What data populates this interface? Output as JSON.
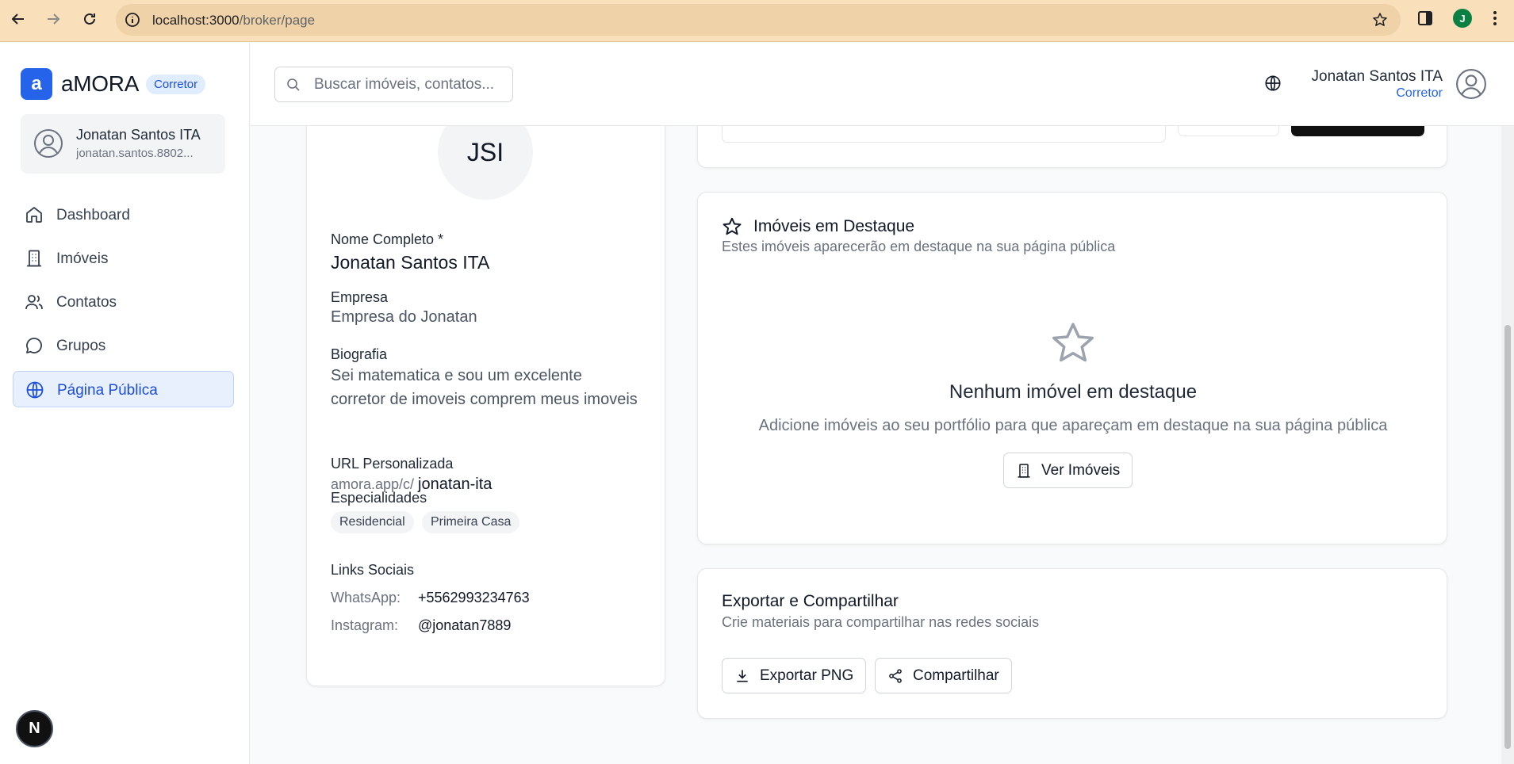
{
  "browser": {
    "url_host": "localhost:3000",
    "url_path": "/broker/page",
    "profile_initial": "J"
  },
  "sidebar": {
    "logo_letter": "a",
    "brand": "aMORA",
    "badge": "Corretor",
    "user_name": "Jonatan Santos ITA",
    "user_email": "jonatan.santos.8802...",
    "items": [
      {
        "label": "Dashboard",
        "icon": "home-icon"
      },
      {
        "label": "Imóveis",
        "icon": "building-icon"
      },
      {
        "label": "Contatos",
        "icon": "users-icon"
      },
      {
        "label": "Grupos",
        "icon": "chat-bubble-icon"
      },
      {
        "label": "Página Pública",
        "icon": "globe-icon",
        "active": true
      }
    ],
    "framework_badge": "N"
  },
  "header": {
    "search_placeholder": "Buscar imóveis, contatos...",
    "user_name": "Jonatan Santos ITA",
    "user_role": "Corretor"
  },
  "profile": {
    "initials": "JSI",
    "full_name_label": "Nome Completo *",
    "full_name": "Jonatan Santos ITA",
    "company_label": "Empresa",
    "company": "Empresa do Jonatan",
    "bio_label": "Biografia",
    "bio": "Sei matematica e sou um excelente corretor de imoveis comprem meus imoveis",
    "url_label": "URL Personalizada",
    "url_prefix": "amora.app/c/",
    "url_slug": "jonatan-ita",
    "specialties_label": "Especialidades",
    "specialties": [
      "Residencial",
      "Primeira Casa"
    ],
    "social_label": "Links Sociais",
    "whatsapp_key": "WhatsApp:",
    "whatsapp": "+5562993234763",
    "instagram_key": "Instagram:",
    "instagram": "@jonatan7889"
  },
  "featured": {
    "title": "Imóveis em Destaque",
    "subtitle": "Estes imóveis aparecerão em destaque na sua página pública",
    "empty_title": "Nenhum imóvel em destaque",
    "empty_subtitle": "Adicione imóveis ao seu portfólio para que apareçam em destaque na sua página pública",
    "button": "Ver Imóveis"
  },
  "export": {
    "title": "Exportar e Compartilhar",
    "subtitle": "Crie materiais para compartilhar nas redes sociais",
    "export_button": "Exportar PNG",
    "share_button": "Compartilhar"
  },
  "colors": {
    "accent": "#2563eb",
    "browser_bar": "#f9dfba"
  }
}
